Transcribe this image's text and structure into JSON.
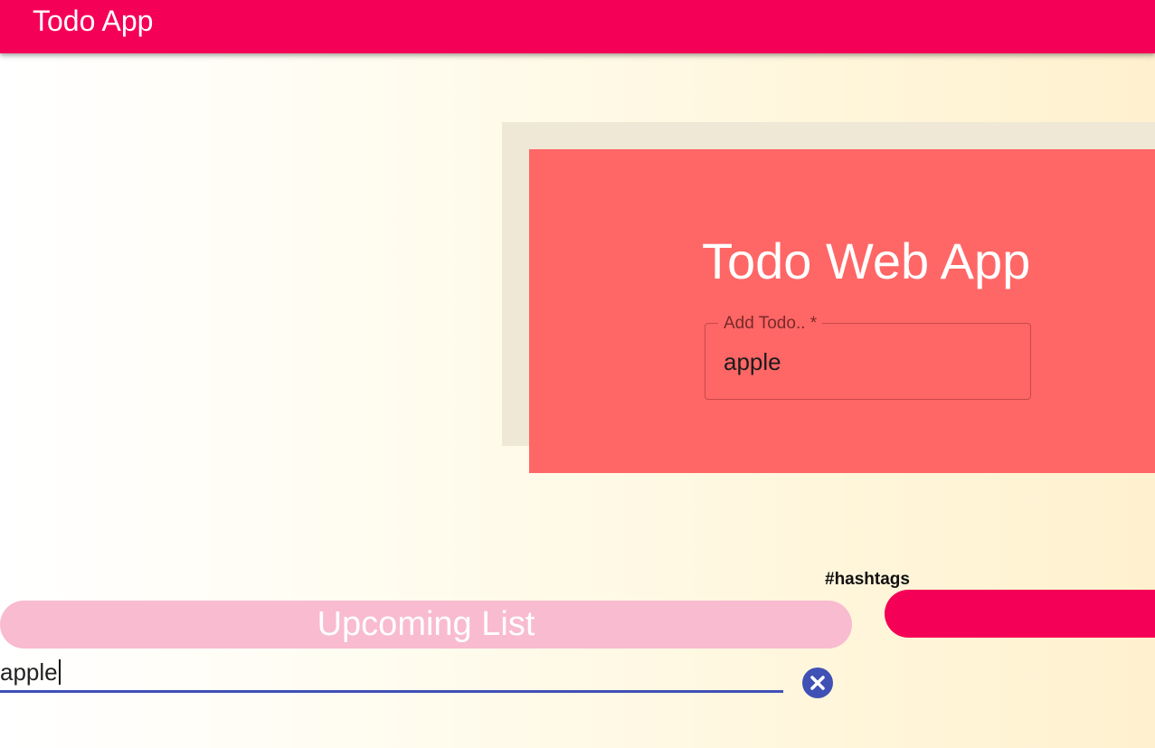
{
  "appbar": {
    "title": "Todo App",
    "color": "#f50057"
  },
  "hero": {
    "title": "Todo Web App",
    "panel_color": "#ff6666"
  },
  "add_todo": {
    "label": "Add Todo.. *",
    "value": "apple"
  },
  "hashtags": {
    "label": "#hashtags"
  },
  "upcoming": {
    "title": "Upcoming List"
  },
  "edit_item": {
    "value": "apple",
    "clear_icon": "close-circle-icon",
    "accent": "#3f51b5"
  }
}
